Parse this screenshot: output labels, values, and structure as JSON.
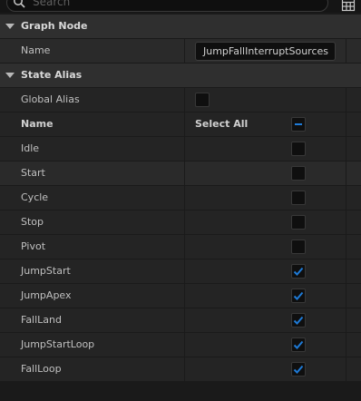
{
  "search": {
    "placeholder": "Search"
  },
  "categories": {
    "graph_node": "Graph Node",
    "state_alias": "State Alias"
  },
  "graph_node": {
    "name_label": "Name",
    "name_value": "JumpFallInterruptSources"
  },
  "state_alias": {
    "global_alias_label": "Global Alias",
    "global_alias_checked": false,
    "header_name": "Name",
    "header_select_all": "Select All",
    "select_all_state": "indeterminate",
    "states": [
      {
        "label": "Idle",
        "checked": false
      },
      {
        "label": "Start",
        "checked": false
      },
      {
        "label": "Cycle",
        "checked": false
      },
      {
        "label": "Stop",
        "checked": false
      },
      {
        "label": "Pivot",
        "checked": false
      },
      {
        "label": "JumpStart",
        "checked": true
      },
      {
        "label": "JumpApex",
        "checked": true
      },
      {
        "label": "FallLand",
        "checked": true
      },
      {
        "label": "JumpStartLoop",
        "checked": true
      },
      {
        "label": "FallLoop",
        "checked": true
      }
    ]
  },
  "colors": {
    "check_accent": "#1e7ad6",
    "background": "#1a1a1a"
  },
  "icons": {
    "search": "magnifier-icon",
    "view_options": "grid-table-icon",
    "collapse": "triangle-down-icon",
    "check": "checkmark-icon",
    "indeterminate": "dash-icon"
  }
}
